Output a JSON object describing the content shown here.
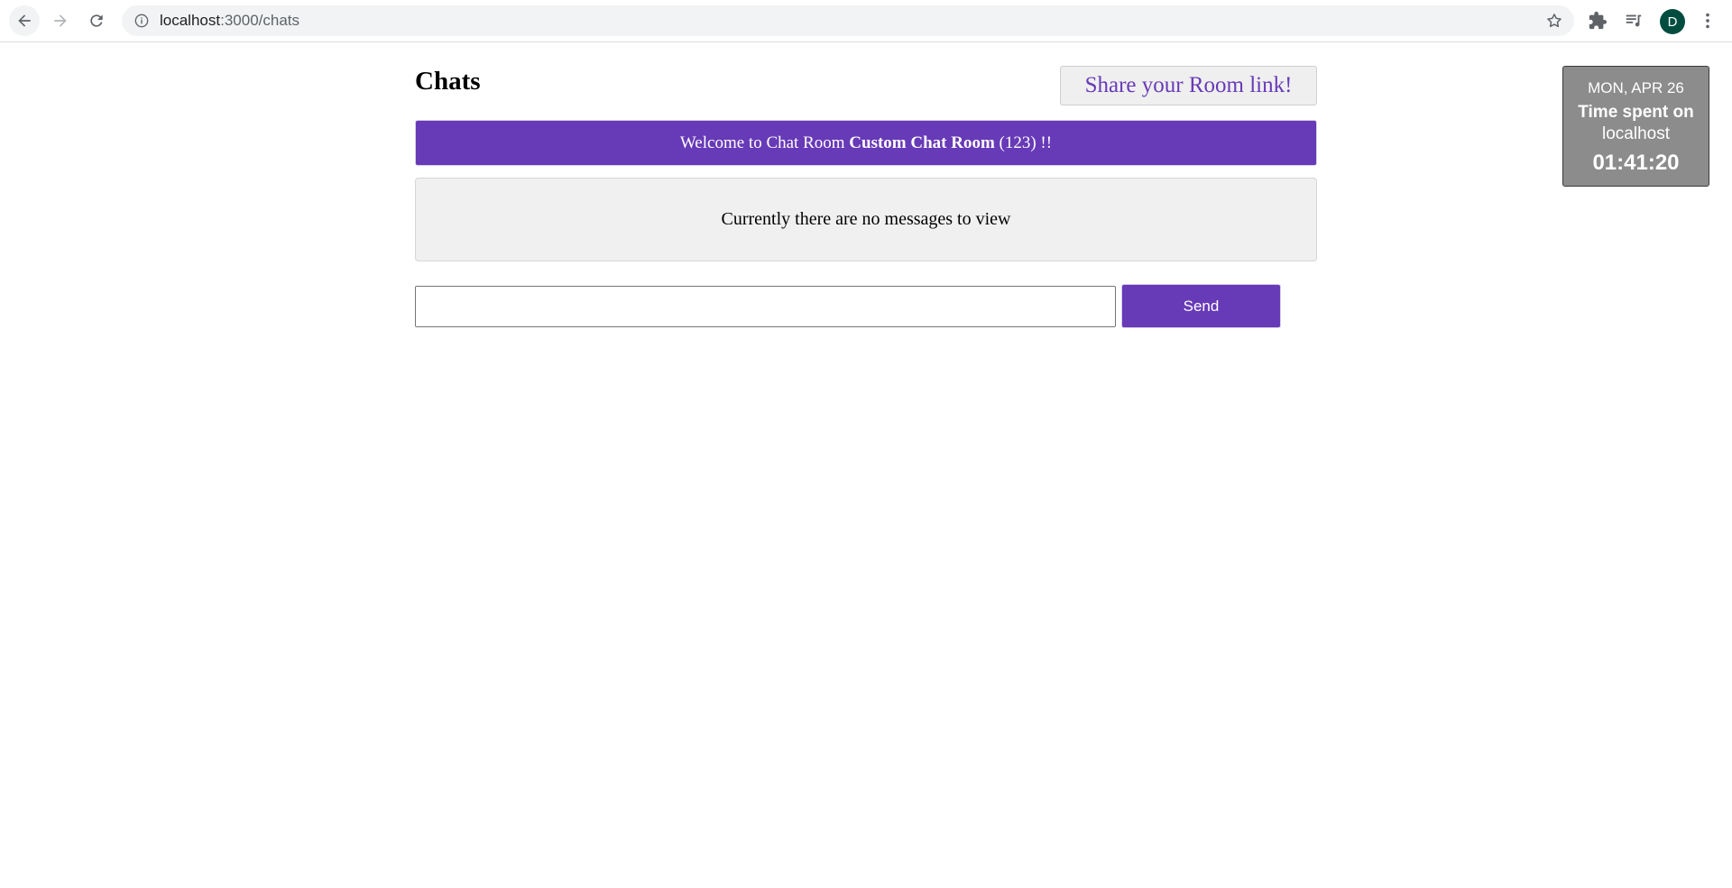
{
  "browser": {
    "url_host": "localhost",
    "url_path": ":3000/chats",
    "profile_initial": "D",
    "icons": {
      "back": "arrow-left-icon",
      "forward": "arrow-right-icon",
      "reload": "reload-icon",
      "site_info": "info-icon",
      "bookmark": "star-icon",
      "extensions": "puzzle-icon",
      "media": "media-queue-icon",
      "menu": "kebab-menu-icon"
    }
  },
  "page": {
    "title": "Chats",
    "share_button_label": "Share your Room link!",
    "welcome": {
      "prefix": "Welcome to Chat Room ",
      "room_name": "Custom Chat Room",
      "suffix": " (123) !!"
    },
    "empty_messages_text": "Currently there are no messages to view",
    "message_input_value": "",
    "message_input_placeholder": "",
    "send_button_label": "Send"
  },
  "time_widget": {
    "date": "MON, APR 26",
    "label": "Time spent on",
    "host": "localhost",
    "time": "01:41:20"
  },
  "colors": {
    "accent": "#673ab7",
    "widget_bg": "#8c8c8c",
    "avatar_bg": "#004d40"
  }
}
